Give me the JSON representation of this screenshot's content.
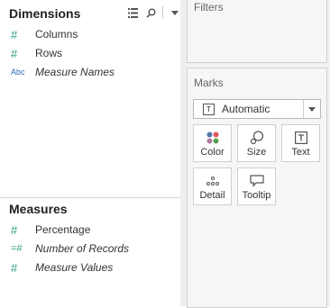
{
  "dimensions": {
    "title": "Dimensions",
    "fields": [
      {
        "icon": "#",
        "label": "Columns",
        "italic": false
      },
      {
        "icon": "#",
        "label": "Rows",
        "italic": false
      },
      {
        "icon": "Abc",
        "label": "Measure Names",
        "italic": true
      }
    ]
  },
  "measures": {
    "title": "Measures",
    "fields": [
      {
        "icon": "#",
        "label": "Percentage",
        "italic": false
      },
      {
        "icon": "=#",
        "label": "Number of Records",
        "italic": true
      },
      {
        "icon": "#",
        "label": "Measure Values",
        "italic": true
      }
    ]
  },
  "filters": {
    "title": "Filters"
  },
  "marks": {
    "title": "Marks",
    "mark_type": "Automatic",
    "mark_type_icon": "T",
    "buttons": [
      {
        "label": "Color",
        "icon": "color-dots-icon"
      },
      {
        "label": "Size",
        "icon": "size-circles-icon"
      },
      {
        "label": "Text",
        "icon": "text-box-icon"
      },
      {
        "label": "Detail",
        "icon": "detail-dots-icon"
      },
      {
        "label": "Tooltip",
        "icon": "tooltip-bubble-icon"
      }
    ]
  },
  "colors": {
    "measure_icon": "#2e9c83",
    "dimension_icon": "#2a6fb5",
    "color_dot_1": "#4e79a7",
    "color_dot_2": "#e15759",
    "color_dot_3": "#b07aa1",
    "color_dot_4": "#59a14f"
  }
}
